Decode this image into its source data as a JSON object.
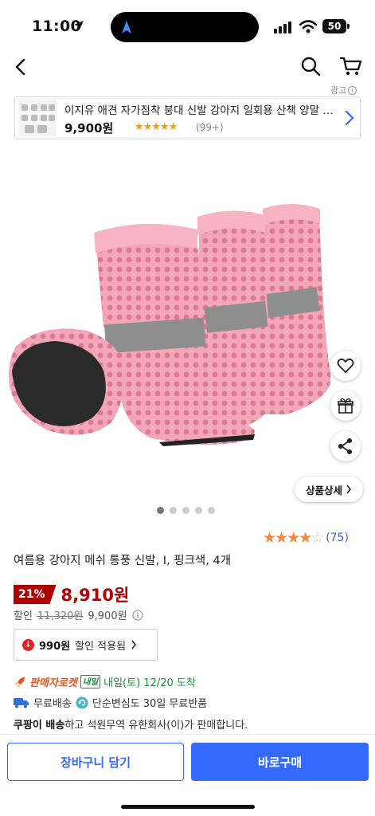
{
  "status_bar": {
    "time": "11:00",
    "battery": "50"
  },
  "ad": {
    "label": "광고",
    "title": "이지유 애견 자가점착 붕대 신발 강아지 일회용 산책 양말 발싸개",
    "price": "9,900원",
    "stars": "★★★★★",
    "review_count": "(99+)"
  },
  "product": {
    "detail_button": "상품상세",
    "image_dots": 5,
    "active_dot": 0,
    "rating_stars_filled": "★★★★",
    "rating_stars_empty": "☆",
    "rating_count": "(75)",
    "title": "여름용 강아지 메쉬 통풍 신발, I, 핑크색, 4개",
    "discount_percent": "21%",
    "sale_price": "8,910원",
    "discount_label": "할인",
    "original_price": "11,320원",
    "discounted_price": "9,900원",
    "coupon_amount": "990원",
    "coupon_text": "할인 적용됨"
  },
  "delivery": {
    "rocket_label": "판매자로켓",
    "tomorrow_badge": "내일",
    "arrival": "내일(토) 12/20 도착",
    "free_shipping": "무료배송",
    "return_policy": "단순변심도 30일 무료반품",
    "seller_prefix": "쿠팡이 배송",
    "seller_suffix": "하고 석원무역 유한회사(이)가 판매합니다."
  },
  "buttons": {
    "add_to_cart": "장바구니 담기",
    "buy_now": "바로구매"
  },
  "colors": {
    "brand_blue": "#346aff",
    "sale_red": "#ae0000",
    "rocket_orange": "#e8551c",
    "delivery_green": "#1b8e3c",
    "star_orange": "#f5883b"
  }
}
